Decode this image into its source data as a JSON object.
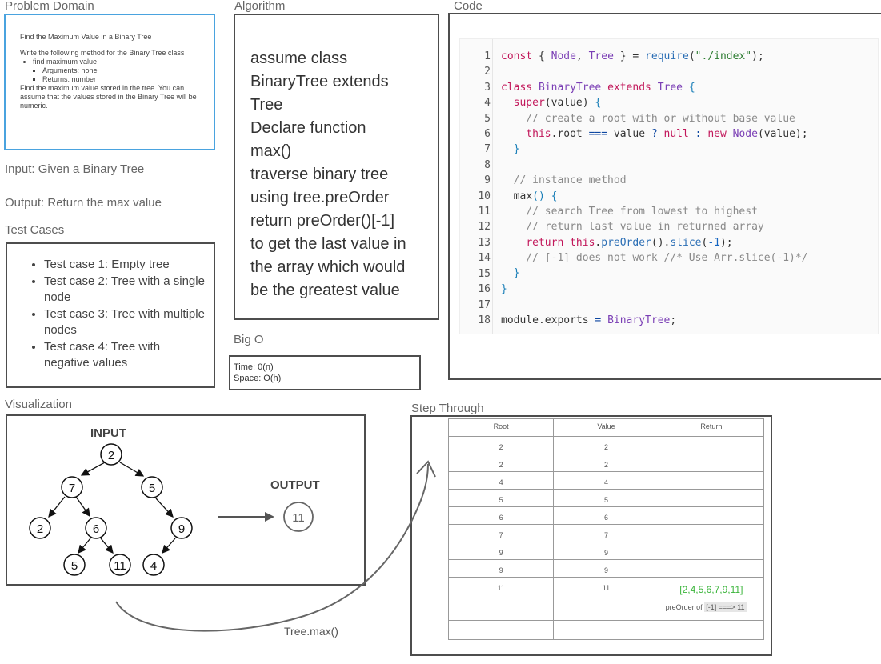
{
  "labels": {
    "problem_domain": "Problem Domain",
    "algorithm": "Algorithm",
    "code": "Code",
    "input": "Input: Given a Binary Tree",
    "output": "Output: Return the max value",
    "test_cases": "Test Cases",
    "big_o": "Big O",
    "visualization": "Visualization",
    "step_through": "Step Through",
    "tree_max": "Tree.max()"
  },
  "problem": {
    "title": "Find the Maximum Value in a Binary Tree",
    "intro": "Write the following method for the Binary Tree class",
    "method": "find maximum value",
    "arguments": "Arguments: none",
    "returns": "Returns: number",
    "description": "Find the maximum value stored in the tree. You can assume that the values stored in the Binary Tree will be numeric."
  },
  "test_cases": [
    "Test case 1: Empty tree",
    "Test case 2: Tree with a single node",
    "Test case 3: Tree with multiple nodes",
    "Test case 4: Tree with negative values"
  ],
  "algorithm": [
    "assume class",
    "BinaryTree extends",
    "Tree",
    "Declare function",
    "max()",
    "traverse binary tree",
    "using tree.preOrder",
    "return preOrder()[-1]",
    "to get the last value in",
    "the array which would",
    "be the greatest value"
  ],
  "big_o": {
    "time": "Time: 0(n)",
    "space": "Space: O(h)"
  },
  "code": {
    "line_numbers": [
      "1",
      "2",
      "3",
      "4",
      "5",
      "6",
      "7",
      "8",
      "9",
      "10",
      "11",
      "12",
      "13",
      "14",
      "15",
      "16",
      "17",
      "18"
    ],
    "lines": [
      [
        {
          "t": "const",
          "c": "kw"
        },
        {
          "t": " { ",
          "c": "p"
        },
        {
          "t": "Node",
          "c": "cls"
        },
        {
          "t": ", ",
          "c": "p"
        },
        {
          "t": "Tree",
          "c": "cls"
        },
        {
          "t": " } = ",
          "c": "p"
        },
        {
          "t": "require",
          "c": "fn"
        },
        {
          "t": "(",
          "c": "p"
        },
        {
          "t": "\"./index\"",
          "c": "str"
        },
        {
          "t": ");",
          "c": "p"
        }
      ],
      [],
      [
        {
          "t": "class",
          "c": "kw"
        },
        {
          "t": " ",
          "c": "p"
        },
        {
          "t": "BinaryTree",
          "c": "cls"
        },
        {
          "t": " ",
          "c": "p"
        },
        {
          "t": "extends",
          "c": "kw"
        },
        {
          "t": " ",
          "c": "p"
        },
        {
          "t": "Tree",
          "c": "cls"
        },
        {
          "t": " {",
          "c": "br"
        }
      ],
      [
        {
          "t": "  ",
          "c": "p"
        },
        {
          "t": "super",
          "c": "kw"
        },
        {
          "t": "(value) ",
          "c": "p"
        },
        {
          "t": "{",
          "c": "br"
        }
      ],
      [
        {
          "t": "    // create a root with or without base value",
          "c": "cm"
        }
      ],
      [
        {
          "t": "    ",
          "c": "p"
        },
        {
          "t": "this",
          "c": "kw"
        },
        {
          "t": ".root ",
          "c": "p"
        },
        {
          "t": "===",
          "c": "op"
        },
        {
          "t": " value ",
          "c": "p"
        },
        {
          "t": "?",
          "c": "op"
        },
        {
          "t": " ",
          "c": "p"
        },
        {
          "t": "null",
          "c": "kw"
        },
        {
          "t": " ",
          "c": "p"
        },
        {
          "t": ":",
          "c": "op"
        },
        {
          "t": " ",
          "c": "p"
        },
        {
          "t": "new",
          "c": "kw"
        },
        {
          "t": " ",
          "c": "p"
        },
        {
          "t": "Node",
          "c": "cls"
        },
        {
          "t": "(value);",
          "c": "p"
        }
      ],
      [
        {
          "t": "  }",
          "c": "br"
        }
      ],
      [],
      [
        {
          "t": "  // instance method",
          "c": "cm"
        }
      ],
      [
        {
          "t": "  max",
          "c": "p"
        },
        {
          "t": "() {",
          "c": "br"
        }
      ],
      [
        {
          "t": "    // search Tree from lowest to highest",
          "c": "cm"
        }
      ],
      [
        {
          "t": "    // return last value in returned array",
          "c": "cm"
        }
      ],
      [
        {
          "t": "    ",
          "c": "p"
        },
        {
          "t": "return",
          "c": "kw"
        },
        {
          "t": " ",
          "c": "p"
        },
        {
          "t": "this",
          "c": "kw"
        },
        {
          "t": ".",
          "c": "p"
        },
        {
          "t": "preOrder",
          "c": "fn"
        },
        {
          "t": "().",
          "c": "p"
        },
        {
          "t": "slice",
          "c": "fn"
        },
        {
          "t": "(",
          "c": "p"
        },
        {
          "t": "-1",
          "c": "num"
        },
        {
          "t": ");",
          "c": "p"
        }
      ],
      [
        {
          "t": "    // [-1] does not work //* Use Arr.slice(-1)*/",
          "c": "cm"
        }
      ],
      [
        {
          "t": "  }",
          "c": "br"
        }
      ],
      [
        {
          "t": "}",
          "c": "br"
        }
      ],
      [],
      [
        {
          "t": "module",
          "c": "p"
        },
        {
          "t": ".exports ",
          "c": "p"
        },
        {
          "t": "=",
          "c": "op"
        },
        {
          "t": " ",
          "c": "p"
        },
        {
          "t": "BinaryTree",
          "c": "cls"
        },
        {
          "t": ";",
          "c": "p"
        }
      ]
    ],
    "colors": {
      "kw": "#c2185b",
      "cls": "#7b3fb5",
      "fn": "#2c6fb5",
      "str": "#2e7d32",
      "cm": "#8a8a8a",
      "br": "#1a7fb8",
      "num": "#1565c0",
      "op": "#0d47a1",
      "p": "#333333"
    }
  },
  "visualization": {
    "input_label": "INPUT",
    "output_label": "OUTPUT",
    "nodes": [
      "2",
      "7",
      "5",
      "2",
      "6",
      "9",
      "5",
      "11",
      "4"
    ],
    "output_value": "11"
  },
  "step_table": {
    "headers": [
      "Root",
      "Value",
      "Return"
    ],
    "rows": [
      [
        "2",
        "2",
        ""
      ],
      [
        "2",
        "2",
        ""
      ],
      [
        "4",
        "4",
        ""
      ],
      [
        "5",
        "5",
        ""
      ],
      [
        "6",
        "6",
        ""
      ],
      [
        "7",
        "7",
        ""
      ],
      [
        "9",
        "9",
        ""
      ],
      [
        "9",
        "9",
        ""
      ],
      [
        "11",
        "11",
        "[2,4,5,6,7,9,11]"
      ],
      [
        "",
        "",
        ""
      ],
      [
        "",
        "",
        ""
      ]
    ],
    "note_prefix": "preOrder of ",
    "note_highlight": "[-1] ===> 11"
  },
  "colors": {
    "problem_border": "#4aa3df",
    "box_border": "#4d4d4d",
    "return_green": "#3cb53c"
  }
}
